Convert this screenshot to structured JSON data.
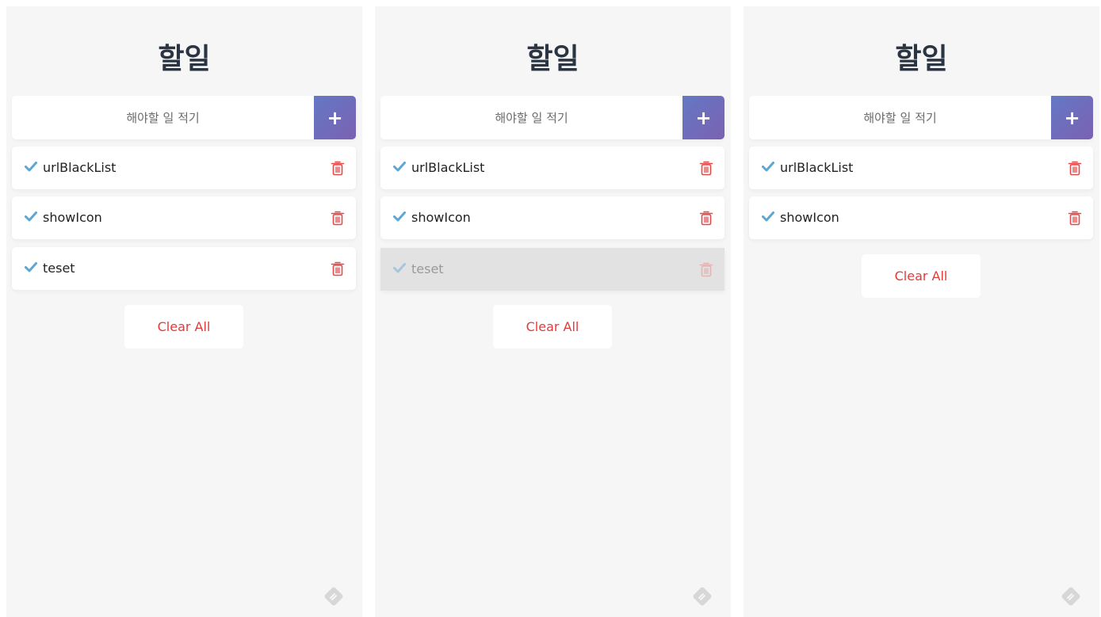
{
  "app": {
    "title": "할일",
    "input_placeholder": "해야할 일 적기",
    "add_label": "+",
    "clear_label": "Clear All",
    "colors": {
      "accent": "#6c6dbb",
      "check": "#5ea7d2",
      "trash": "#e34c4c",
      "clear_text": "#e33a3a"
    },
    "icons": {
      "check": "check-icon",
      "trash": "trash-icon",
      "brand": "brand-logo-icon"
    }
  },
  "panels": [
    {
      "title": "할일",
      "placeholder": "해야할 일 적기",
      "items": [
        {
          "text": "urlBlackList",
          "state": "normal"
        },
        {
          "text": "showIcon",
          "state": "normal"
        },
        {
          "text": "teset",
          "state": "normal"
        }
      ],
      "clear_label": "Clear All"
    },
    {
      "title": "할일",
      "placeholder": "해야할 일 적기",
      "items": [
        {
          "text": "urlBlackList",
          "state": "normal"
        },
        {
          "text": "showIcon",
          "state": "normal"
        },
        {
          "text": "teset",
          "state": "removing"
        }
      ],
      "clear_label": "Clear All"
    },
    {
      "title": "할일",
      "placeholder": "해야할 일 적기",
      "items": [
        {
          "text": "urlBlackList",
          "state": "normal"
        },
        {
          "text": "showIcon",
          "state": "normal"
        }
      ],
      "clear_label": "Clear All"
    }
  ]
}
